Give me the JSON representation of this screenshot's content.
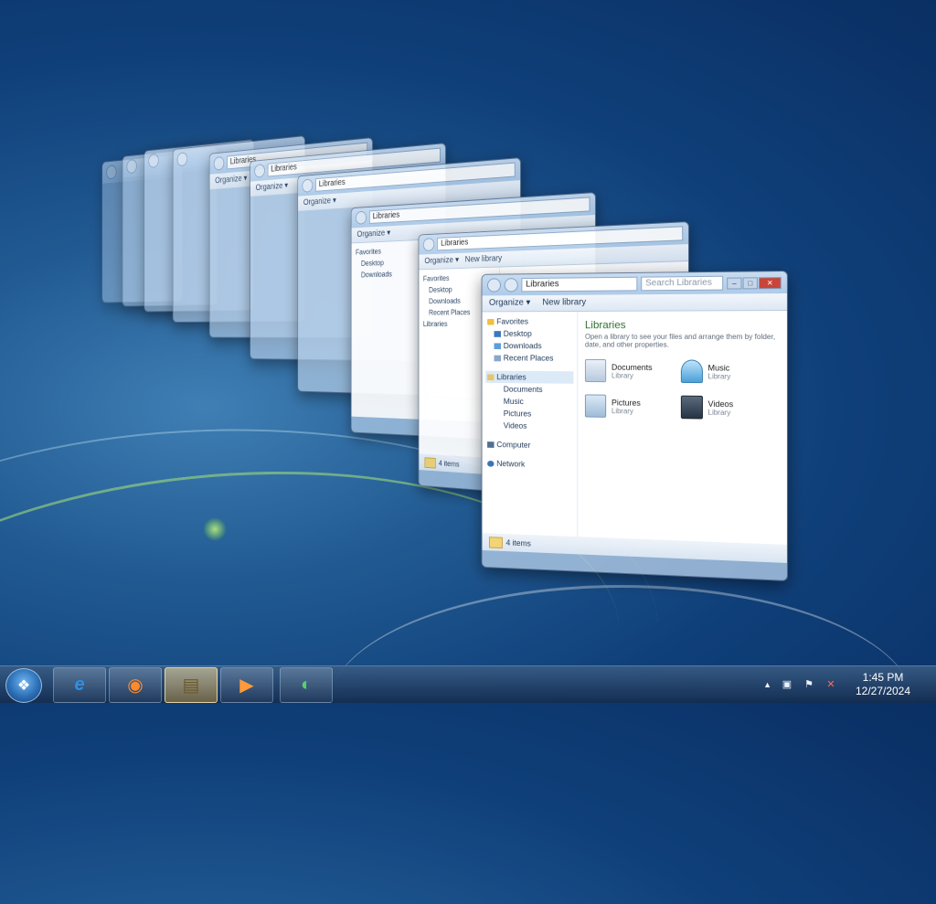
{
  "desktop": {
    "colors": {
      "accent": "#215a92",
      "taskbar": "#1f3f66"
    }
  },
  "explorer": {
    "address_root": "Libraries",
    "command_bar": {
      "organize": "Organize ▾",
      "new_library": "New library"
    },
    "search_placeholder": "Search Libraries",
    "nav_pane": {
      "favorites_header": "Favorites",
      "favorites": [
        "Desktop",
        "Downloads",
        "Recent Places"
      ],
      "libraries_header": "Libraries",
      "libraries": [
        "Documents",
        "Music",
        "Pictures",
        "Videos"
      ],
      "computer": "Computer",
      "network": "Network"
    },
    "content": {
      "title": "Libraries",
      "subtitle": "Open a library to see your files and arrange them by folder, date, and other properties.",
      "tiles": [
        {
          "name": "Documents",
          "type": "Library",
          "icon": "documents-library-icon"
        },
        {
          "name": "Music",
          "type": "Library",
          "icon": "music-library-icon"
        },
        {
          "name": "Pictures",
          "type": "Library",
          "icon": "pictures-library-icon"
        },
        {
          "name": "Videos",
          "type": "Library",
          "icon": "videos-library-icon"
        }
      ]
    },
    "status": "4 items"
  },
  "taskbar": {
    "apps": [
      {
        "name": "internet-explorer",
        "glyph": "e"
      },
      {
        "name": "firefox",
        "glyph": "◉"
      },
      {
        "name": "windows-explorer",
        "glyph": "▤"
      },
      {
        "name": "media-player",
        "glyph": "▶"
      },
      {
        "name": "green-app",
        "glyph": "◐"
      }
    ],
    "clock_time": "1:45 PM",
    "clock_date": "12/27/2024",
    "tray_arrow": "▲"
  }
}
